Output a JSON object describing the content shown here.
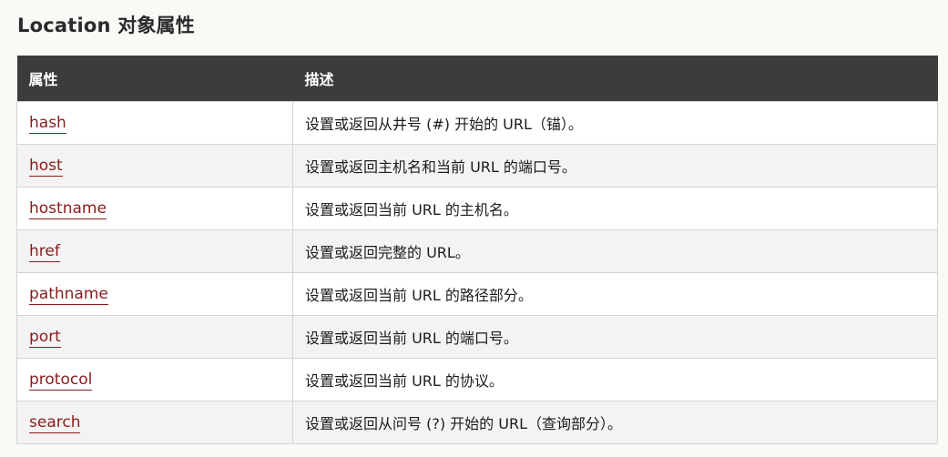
{
  "heading": "Location 对象属性",
  "table": {
    "headers": [
      "属性",
      "描述"
    ],
    "rows": [
      {
        "property": "hash",
        "description": "设置或返回从井号 (#) 开始的 URL（锚）。"
      },
      {
        "property": "host",
        "description": "设置或返回主机名和当前 URL 的端口号。"
      },
      {
        "property": "hostname",
        "description": "设置或返回当前 URL 的主机名。"
      },
      {
        "property": "href",
        "description": "设置或返回完整的 URL。"
      },
      {
        "property": "pathname",
        "description": "设置或返回当前 URL 的路径部分。"
      },
      {
        "property": "port",
        "description": "设置或返回当前 URL 的端口号。"
      },
      {
        "property": "protocol",
        "description": "设置或返回当前 URL 的协议。"
      },
      {
        "property": "search",
        "description": "设置或返回从问号 (?) 开始的 URL（查询部分）。"
      }
    ]
  }
}
